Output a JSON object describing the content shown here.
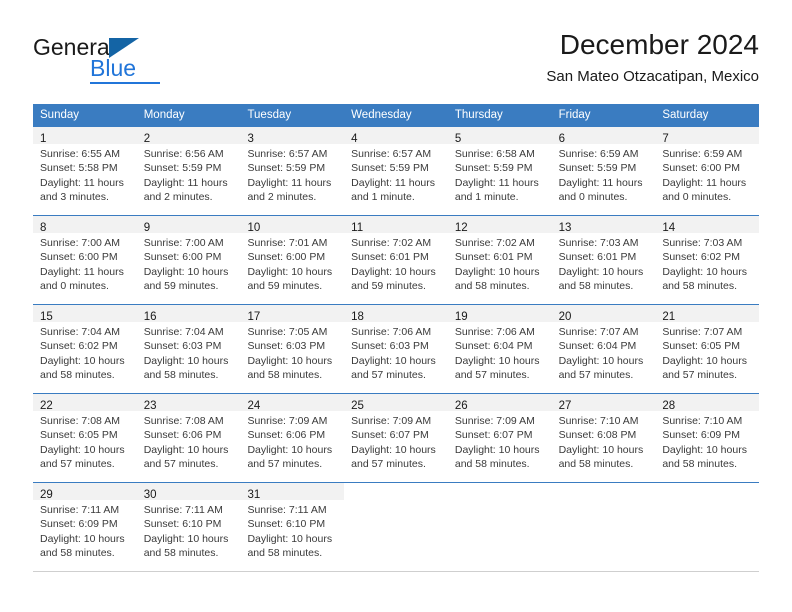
{
  "brand": {
    "name_part1": "General",
    "name_part2": "Blue",
    "triangle_color": "#1464a5",
    "blue_color": "#2175d9"
  },
  "header": {
    "title": "December 2024",
    "subtitle": "San Mateo Otzacatipan, Mexico"
  },
  "theme": {
    "header_blue": "#3a7cc1",
    "day_band_gray": "#f2f2f2",
    "text_color": "#3a3a3a"
  },
  "weekdays": [
    "Sunday",
    "Monday",
    "Tuesday",
    "Wednesday",
    "Thursday",
    "Friday",
    "Saturday"
  ],
  "weeks": [
    [
      {
        "day": "1",
        "sunrise": "Sunrise: 6:55 AM",
        "sunset": "Sunset: 5:58 PM",
        "daylight1": "Daylight: 11 hours",
        "daylight2": "and 3 minutes."
      },
      {
        "day": "2",
        "sunrise": "Sunrise: 6:56 AM",
        "sunset": "Sunset: 5:59 PM",
        "daylight1": "Daylight: 11 hours",
        "daylight2": "and 2 minutes."
      },
      {
        "day": "3",
        "sunrise": "Sunrise: 6:57 AM",
        "sunset": "Sunset: 5:59 PM",
        "daylight1": "Daylight: 11 hours",
        "daylight2": "and 2 minutes."
      },
      {
        "day": "4",
        "sunrise": "Sunrise: 6:57 AM",
        "sunset": "Sunset: 5:59 PM",
        "daylight1": "Daylight: 11 hours",
        "daylight2": "and 1 minute."
      },
      {
        "day": "5",
        "sunrise": "Sunrise: 6:58 AM",
        "sunset": "Sunset: 5:59 PM",
        "daylight1": "Daylight: 11 hours",
        "daylight2": "and 1 minute."
      },
      {
        "day": "6",
        "sunrise": "Sunrise: 6:59 AM",
        "sunset": "Sunset: 5:59 PM",
        "daylight1": "Daylight: 11 hours",
        "daylight2": "and 0 minutes."
      },
      {
        "day": "7",
        "sunrise": "Sunrise: 6:59 AM",
        "sunset": "Sunset: 6:00 PM",
        "daylight1": "Daylight: 11 hours",
        "daylight2": "and 0 minutes."
      }
    ],
    [
      {
        "day": "8",
        "sunrise": "Sunrise: 7:00 AM",
        "sunset": "Sunset: 6:00 PM",
        "daylight1": "Daylight: 11 hours",
        "daylight2": "and 0 minutes."
      },
      {
        "day": "9",
        "sunrise": "Sunrise: 7:00 AM",
        "sunset": "Sunset: 6:00 PM",
        "daylight1": "Daylight: 10 hours",
        "daylight2": "and 59 minutes."
      },
      {
        "day": "10",
        "sunrise": "Sunrise: 7:01 AM",
        "sunset": "Sunset: 6:00 PM",
        "daylight1": "Daylight: 10 hours",
        "daylight2": "and 59 minutes."
      },
      {
        "day": "11",
        "sunrise": "Sunrise: 7:02 AM",
        "sunset": "Sunset: 6:01 PM",
        "daylight1": "Daylight: 10 hours",
        "daylight2": "and 59 minutes."
      },
      {
        "day": "12",
        "sunrise": "Sunrise: 7:02 AM",
        "sunset": "Sunset: 6:01 PM",
        "daylight1": "Daylight: 10 hours",
        "daylight2": "and 58 minutes."
      },
      {
        "day": "13",
        "sunrise": "Sunrise: 7:03 AM",
        "sunset": "Sunset: 6:01 PM",
        "daylight1": "Daylight: 10 hours",
        "daylight2": "and 58 minutes."
      },
      {
        "day": "14",
        "sunrise": "Sunrise: 7:03 AM",
        "sunset": "Sunset: 6:02 PM",
        "daylight1": "Daylight: 10 hours",
        "daylight2": "and 58 minutes."
      }
    ],
    [
      {
        "day": "15",
        "sunrise": "Sunrise: 7:04 AM",
        "sunset": "Sunset: 6:02 PM",
        "daylight1": "Daylight: 10 hours",
        "daylight2": "and 58 minutes."
      },
      {
        "day": "16",
        "sunrise": "Sunrise: 7:04 AM",
        "sunset": "Sunset: 6:03 PM",
        "daylight1": "Daylight: 10 hours",
        "daylight2": "and 58 minutes."
      },
      {
        "day": "17",
        "sunrise": "Sunrise: 7:05 AM",
        "sunset": "Sunset: 6:03 PM",
        "daylight1": "Daylight: 10 hours",
        "daylight2": "and 58 minutes."
      },
      {
        "day": "18",
        "sunrise": "Sunrise: 7:06 AM",
        "sunset": "Sunset: 6:03 PM",
        "daylight1": "Daylight: 10 hours",
        "daylight2": "and 57 minutes."
      },
      {
        "day": "19",
        "sunrise": "Sunrise: 7:06 AM",
        "sunset": "Sunset: 6:04 PM",
        "daylight1": "Daylight: 10 hours",
        "daylight2": "and 57 minutes."
      },
      {
        "day": "20",
        "sunrise": "Sunrise: 7:07 AM",
        "sunset": "Sunset: 6:04 PM",
        "daylight1": "Daylight: 10 hours",
        "daylight2": "and 57 minutes."
      },
      {
        "day": "21",
        "sunrise": "Sunrise: 7:07 AM",
        "sunset": "Sunset: 6:05 PM",
        "daylight1": "Daylight: 10 hours",
        "daylight2": "and 57 minutes."
      }
    ],
    [
      {
        "day": "22",
        "sunrise": "Sunrise: 7:08 AM",
        "sunset": "Sunset: 6:05 PM",
        "daylight1": "Daylight: 10 hours",
        "daylight2": "and 57 minutes."
      },
      {
        "day": "23",
        "sunrise": "Sunrise: 7:08 AM",
        "sunset": "Sunset: 6:06 PM",
        "daylight1": "Daylight: 10 hours",
        "daylight2": "and 57 minutes."
      },
      {
        "day": "24",
        "sunrise": "Sunrise: 7:09 AM",
        "sunset": "Sunset: 6:06 PM",
        "daylight1": "Daylight: 10 hours",
        "daylight2": "and 57 minutes."
      },
      {
        "day": "25",
        "sunrise": "Sunrise: 7:09 AM",
        "sunset": "Sunset: 6:07 PM",
        "daylight1": "Daylight: 10 hours",
        "daylight2": "and 57 minutes."
      },
      {
        "day": "26",
        "sunrise": "Sunrise: 7:09 AM",
        "sunset": "Sunset: 6:07 PM",
        "daylight1": "Daylight: 10 hours",
        "daylight2": "and 58 minutes."
      },
      {
        "day": "27",
        "sunrise": "Sunrise: 7:10 AM",
        "sunset": "Sunset: 6:08 PM",
        "daylight1": "Daylight: 10 hours",
        "daylight2": "and 58 minutes."
      },
      {
        "day": "28",
        "sunrise": "Sunrise: 7:10 AM",
        "sunset": "Sunset: 6:09 PM",
        "daylight1": "Daylight: 10 hours",
        "daylight2": "and 58 minutes."
      }
    ],
    [
      {
        "day": "29",
        "sunrise": "Sunrise: 7:11 AM",
        "sunset": "Sunset: 6:09 PM",
        "daylight1": "Daylight: 10 hours",
        "daylight2": "and 58 minutes."
      },
      {
        "day": "30",
        "sunrise": "Sunrise: 7:11 AM",
        "sunset": "Sunset: 6:10 PM",
        "daylight1": "Daylight: 10 hours",
        "daylight2": "and 58 minutes."
      },
      {
        "day": "31",
        "sunrise": "Sunrise: 7:11 AM",
        "sunset": "Sunset: 6:10 PM",
        "daylight1": "Daylight: 10 hours",
        "daylight2": "and 58 minutes."
      },
      {
        "day": "",
        "sunrise": "",
        "sunset": "",
        "daylight1": "",
        "daylight2": ""
      },
      {
        "day": "",
        "sunrise": "",
        "sunset": "",
        "daylight1": "",
        "daylight2": ""
      },
      {
        "day": "",
        "sunrise": "",
        "sunset": "",
        "daylight1": "",
        "daylight2": ""
      },
      {
        "day": "",
        "sunrise": "",
        "sunset": "",
        "daylight1": "",
        "daylight2": ""
      }
    ]
  ]
}
